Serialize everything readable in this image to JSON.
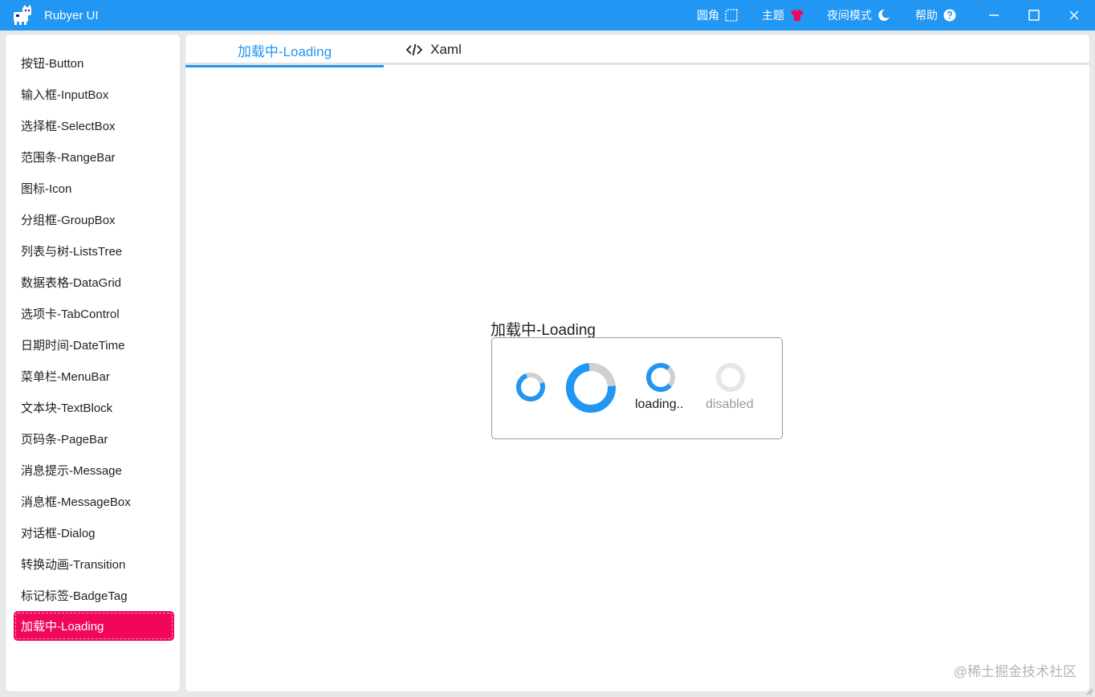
{
  "app": {
    "title": "Rubyer UI"
  },
  "titlebar_actions": {
    "radius_label": "圆角",
    "theme_label": "主题",
    "night_label": "夜间模式",
    "help_label": "帮助"
  },
  "sidebar": {
    "items": [
      {
        "label": "按钮-Button"
      },
      {
        "label": "输入框-InputBox"
      },
      {
        "label": "选择框-SelectBox"
      },
      {
        "label": "范围条-RangeBar"
      },
      {
        "label": "图标-Icon"
      },
      {
        "label": "分组框-GroupBox"
      },
      {
        "label": "列表与树-ListsTree"
      },
      {
        "label": "数据表格-DataGrid"
      },
      {
        "label": "选项卡-TabControl"
      },
      {
        "label": "日期时间-DateTime"
      },
      {
        "label": "菜单栏-MenuBar"
      },
      {
        "label": "文本块-TextBlock"
      },
      {
        "label": "页码条-PageBar"
      },
      {
        "label": "消息提示-Message"
      },
      {
        "label": "消息框-MessageBox"
      },
      {
        "label": "对话框-Dialog"
      },
      {
        "label": "转换动画-Transition"
      },
      {
        "label": "标记标签-BadgeTag"
      },
      {
        "label": "加载中-Loading"
      }
    ],
    "active_index": 18
  },
  "tabs": [
    {
      "label": "加载中-Loading",
      "active": true
    },
    {
      "label": "Xaml",
      "icon": "code-icon",
      "active": false
    }
  ],
  "demo": {
    "group_title": "加载中-Loading",
    "spinners": [
      {
        "name": "small-loading-spinner",
        "progress": 0.75,
        "label": ""
      },
      {
        "name": "large-loading-spinner",
        "progress": 0.75,
        "label": ""
      },
      {
        "name": "labeled-loading-spinner",
        "progress": 0.75,
        "label": "loading.."
      },
      {
        "name": "disabled-loading-spinner",
        "progress": 0,
        "label": "disabled"
      }
    ]
  },
  "watermark": "@稀土掘金技术社区",
  "colors": {
    "primary": "#2196F3",
    "accent": "#F0075C",
    "track": "#D0D0D0",
    "disabled": "#E6E6E6"
  }
}
